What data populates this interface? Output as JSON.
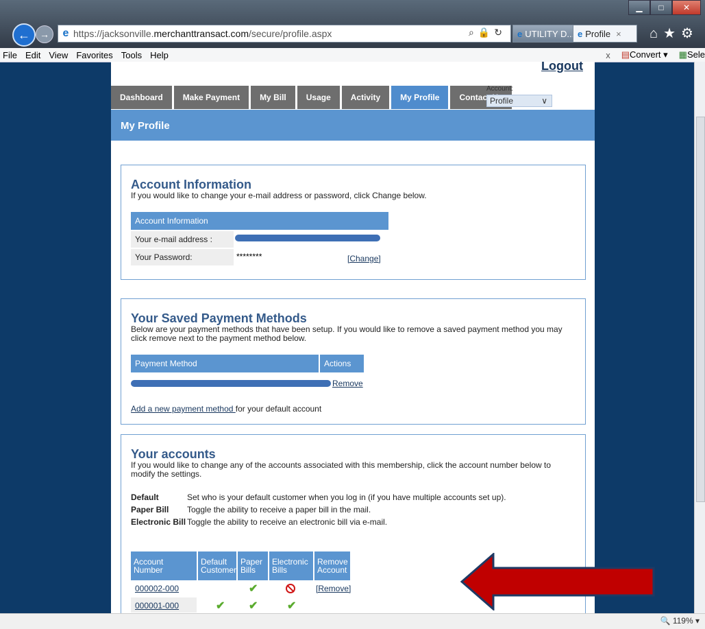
{
  "browser": {
    "url_prefix": "https://jacksonville.",
    "url_host": "merchanttransact.com",
    "url_path": "/secure/profile.aspx",
    "tab1": "UTILITY D...",
    "tab2": "Profile",
    "menu": [
      "File",
      "Edit",
      "View",
      "Favorites",
      "Tools",
      "Help"
    ],
    "menu_right_x": "x",
    "convert": "Convert",
    "select": "Sele",
    "zoom": "119%"
  },
  "header": {
    "logout": "Logout",
    "tabs": [
      "Dashboard",
      "Make Payment",
      "My Bill",
      "Usage",
      "Activity",
      "My Profile",
      "Contact Us"
    ],
    "active_tab": "My Profile",
    "account_label": "Account:",
    "account_value": "Profile",
    "page_title": "My Profile"
  },
  "account_info": {
    "heading": "Account Information",
    "desc": "If you would like to change your e-mail address or password, click Change below.",
    "table_header": "Account Information",
    "email_label": "Your e-mail address :",
    "password_label": "Your Password:",
    "password_value": "********",
    "change_link": "[Change]"
  },
  "payment_methods": {
    "heading": "Your Saved Payment Methods",
    "desc": "Below are your payment methods that have been setup. If you would like to remove a saved payment method you may click remove next to the payment method below.",
    "col_method": "Payment Method",
    "col_actions": "Actions",
    "remove": "Remove",
    "add_link": "Add a new payment method ",
    "add_suffix": "for your default account"
  },
  "accounts": {
    "heading": "Your accounts",
    "desc": "If you would like to change any of the accounts associated with this membership, click the account number below to modify the settings.",
    "definitions": [
      {
        "term": "Default",
        "text": "Set who is your default customer when you log in (if you have multiple accounts set up)."
      },
      {
        "term": "Paper Bill",
        "text": "Toggle the ability to receive a paper bill in the mail."
      },
      {
        "term": "Electronic Bill",
        "text": "Toggle the ability to receive an electronic bill via e-mail."
      }
    ],
    "columns": [
      "Account Number",
      "Default Customer",
      "Paper Bills",
      "Electronic Bills",
      "Remove Account"
    ],
    "rows": [
      {
        "number": "000002-000",
        "default": false,
        "paper": true,
        "electronic": "blocked",
        "remove": "[Remove]"
      },
      {
        "number": "000001-000",
        "default": true,
        "paper": true,
        "electronic": true,
        "remove": ""
      }
    ]
  },
  "colors": {
    "accent_blue": "#5b95d0",
    "nav_gray": "#6e6e6e",
    "background_navy": "#0d3a68",
    "arrow_red": "#c00000"
  }
}
